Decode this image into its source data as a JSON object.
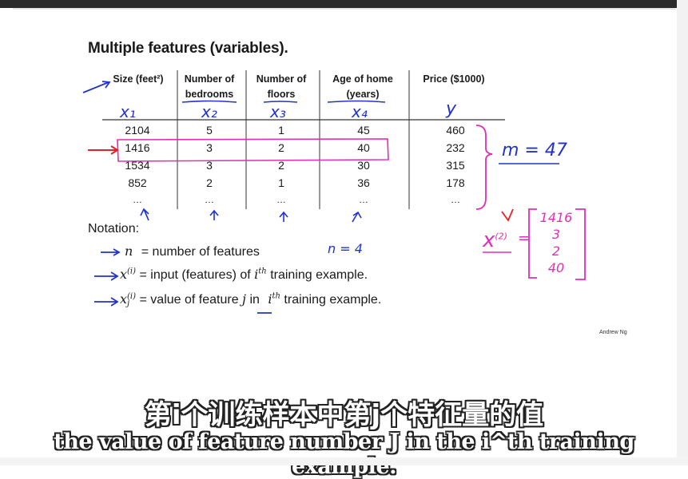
{
  "slide": {
    "title": "Multiple features (variables).",
    "headers": [
      {
        "line1": "Size (feet²)",
        "line2": "",
        "var": "x₁"
      },
      {
        "line1": "Number of",
        "line2": "bedrooms",
        "var": "x₂"
      },
      {
        "line1": "Number of",
        "line2": "floors",
        "var": "x₃"
      },
      {
        "line1": "Age of home",
        "line2": "(years)",
        "var": "x₄"
      },
      {
        "line1": "Price ($1000)",
        "line2": "",
        "var": "y"
      }
    ],
    "rows": [
      [
        "2104",
        "5",
        "1",
        "45",
        "460"
      ],
      [
        "1416",
        "3",
        "2",
        "40",
        "232"
      ],
      [
        "1534",
        "3",
        "2",
        "30",
        "315"
      ],
      [
        "852",
        "2",
        "1",
        "36",
        "178"
      ],
      [
        "…",
        "…",
        "…",
        "…",
        "…"
      ]
    ],
    "m_note": "m = 47",
    "n_note": "n = 4",
    "x2_label": "x",
    "x2_sup": "(2)",
    "x2_eq": "=",
    "x2_vector": [
      "1416",
      "3",
      "2",
      "40"
    ],
    "notation_label": "Notation:",
    "notation": [
      {
        "sym": "n",
        "sup": "",
        "sub": "",
        "text": "= number of features"
      },
      {
        "sym": "x",
        "sup": "(i)",
        "sub": "",
        "text_a": "= input (features) of",
        "ith": "i",
        "ith_sup": "th",
        "text_b": "training example."
      },
      {
        "sym": "x",
        "sup": "(i)",
        "sub": "j",
        "text_a": "= value of feature",
        "j": "j",
        "text_in": "in",
        "ith": "i",
        "ith_sup": "th",
        "text_b": "training example."
      }
    ],
    "credit": "Andrew Ng"
  },
  "subtitles": {
    "chinese": "第i个训练样本中第j个特征量的值",
    "english": "the value of feature number J in the i^th training example."
  },
  "colors": {
    "ink_blue": "#2233cc",
    "ink_pink": "#e02fb0",
    "ink_red": "#e0202a"
  }
}
